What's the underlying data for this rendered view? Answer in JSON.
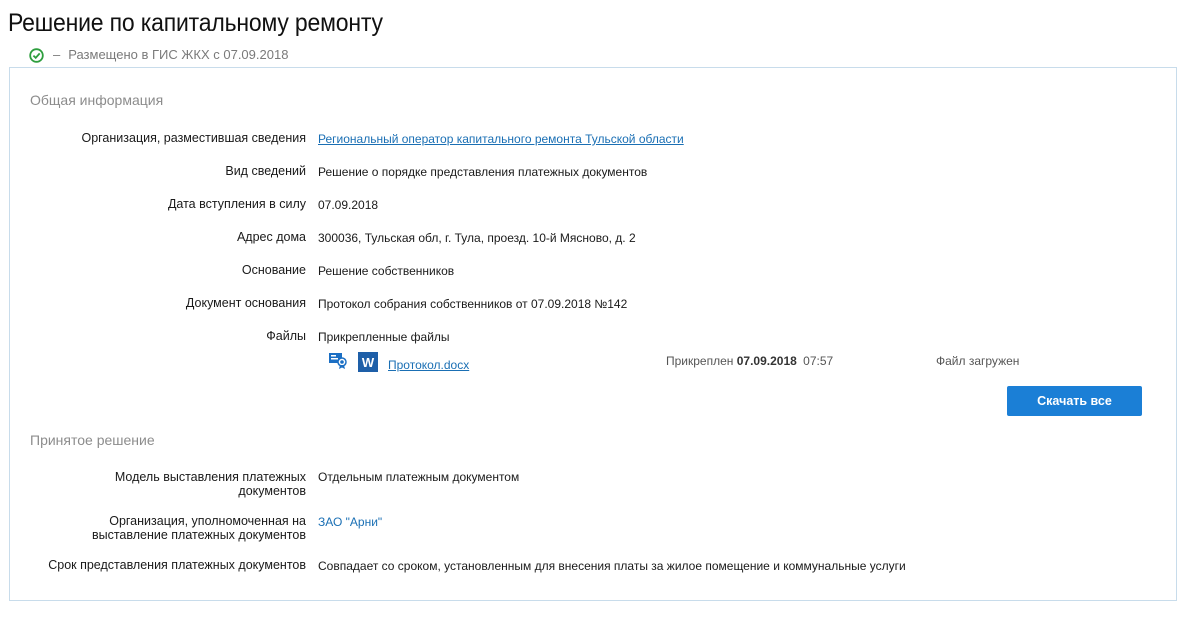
{
  "page": {
    "title": "Решение по капитальному ремонту",
    "status_dash": "–",
    "status_text": "Размещено в ГИС ЖКХ с 07.09.2018"
  },
  "general": {
    "title": "Общая информация",
    "rows": [
      {
        "label": "Организация, разместившая сведения",
        "value": "Региональный оператор капитального ремонта Тульской области"
      },
      {
        "label": "Вид сведений",
        "value": "Решение о порядке представления платежных документов"
      },
      {
        "label": "Дата вступления в силу",
        "value": "07.09.2018"
      },
      {
        "label": "Адрес дома",
        "value": "300036, Тульская обл, г. Тула, проезд. 10-й Мясново, д. 2"
      },
      {
        "label": "Основание",
        "value": "Решение собственников"
      },
      {
        "label": "Документ основания",
        "value": "Протокол собрания собственников от 07.09.2018 №142"
      },
      {
        "label": "Файлы",
        "value": "Прикрепленные файлы"
      }
    ],
    "file": {
      "name": "Протокол.docx",
      "attached_prefix": "Прикреплен",
      "attached_date": "07.09.2018",
      "attached_time": "07:57",
      "status": "Файл загружен",
      "icons": [
        "signature-icon",
        "word-document-icon"
      ]
    },
    "download_all": "Скачать все"
  },
  "decision": {
    "title": "Принятое решение",
    "rows": [
      {
        "label_line1": "Модель выставления платежных",
        "label_line2": "документов",
        "value": "Отдельным платежным документом"
      },
      {
        "label_line1": "Организация, уполномоченная на",
        "label_line2": "выставление платежных документов",
        "value": "ЗАО \"Арни\""
      },
      {
        "label": "Срок представления платежных документов",
        "value": "Совпадает со сроком, установленным для внесения платы за жилое помещение и коммунальные услуги"
      }
    ]
  },
  "colors": {
    "link": "#1a6fb4",
    "button": "#1b7fd6",
    "status_ok": "#2e9e3e",
    "card_border": "#c8dceb"
  }
}
